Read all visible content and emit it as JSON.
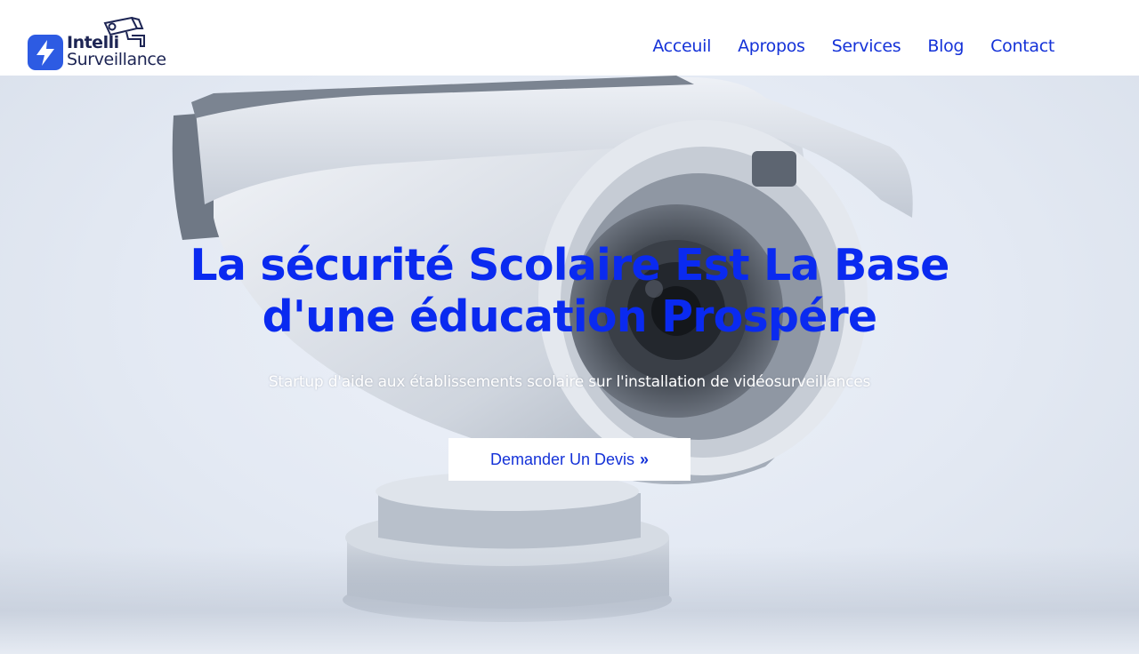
{
  "brand": {
    "name_line1": "Intelli",
    "name_line2": "Surveillance",
    "color": "#2d5be3",
    "logo_icons": [
      "lightning-bolt-icon",
      "security-camera-icon"
    ]
  },
  "nav": {
    "items": [
      {
        "label": "Acceuil"
      },
      {
        "label": "Apropos"
      },
      {
        "label": "Services"
      },
      {
        "label": "Blog"
      },
      {
        "label": "Contact"
      }
    ],
    "color": "#1432d8"
  },
  "hero": {
    "title_line1": "La sécurité Scolaire Est La Base",
    "title_line2": "d'une éducation Prospére",
    "subtitle": "Startup d'aide aux établissements scolaire sur l'installation de vidéosurveillances",
    "cta_label": "Demander Un Devis",
    "cta_icon": "double-chevron-right-icon",
    "title_color": "#0a2af0",
    "background_image": "security-camera-photo"
  }
}
